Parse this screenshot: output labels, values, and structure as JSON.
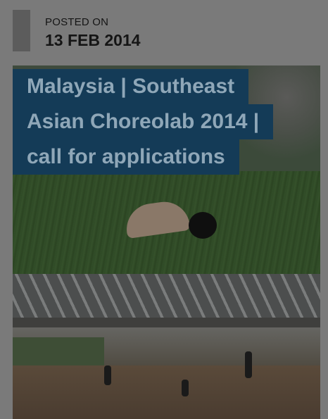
{
  "post": {
    "posted_label": "POSTED ON",
    "posted_date": "13 FEB 2014",
    "title_lines": [
      "Malaysia | Southeast",
      "Asian Choreolab 2014 |",
      "call for applications"
    ]
  },
  "colors": {
    "page_overlay": "#7a7a7a",
    "date_bar": "#5c5c5c",
    "title_background": "#143b57",
    "title_text": "#8fa7b8"
  }
}
